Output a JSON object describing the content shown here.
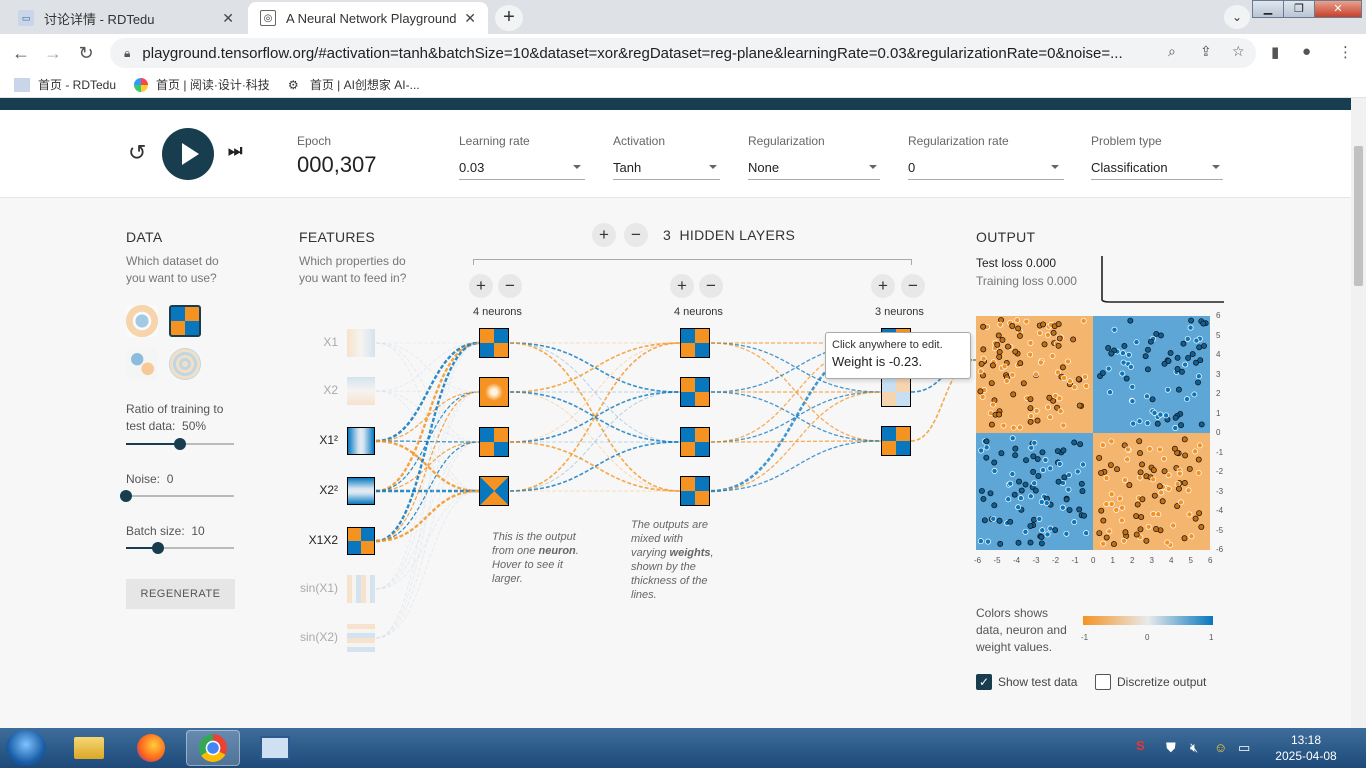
{
  "browser": {
    "tabs": [
      {
        "title": "讨论详情 - RDTedu",
        "active": false
      },
      {
        "title": "A Neural Network Playground",
        "active": true
      }
    ],
    "url": "playground.tensorflow.org/#activation=tanh&batchSize=10&dataset=xor&regDataset=reg-plane&learningRate=0.03&regularizationRate=0&noise=...",
    "bookmarks": [
      "首页 - RDTedu",
      "首页 | 阅读·设计·科技",
      "首页 | AI创想家 AI-..."
    ]
  },
  "controls": {
    "epoch_label": "Epoch",
    "epoch_value": "000,307",
    "learning_rate": {
      "label": "Learning rate",
      "value": "0.03"
    },
    "activation": {
      "label": "Activation",
      "value": "Tanh"
    },
    "regularization": {
      "label": "Regularization",
      "value": "None"
    },
    "regularization_rate": {
      "label": "Regularization rate",
      "value": "0"
    },
    "problem_type": {
      "label": "Problem type",
      "value": "Classification"
    }
  },
  "data_panel": {
    "title": "DATA",
    "question": "Which dataset do you want to use?",
    "ratio_label": "Ratio of training to test data:",
    "ratio_value": "50%",
    "ratio_fraction": 0.5,
    "noise_label": "Noise:",
    "noise_value": "0",
    "noise_fraction": 0,
    "batch_label": "Batch size:",
    "batch_value": "10",
    "batch_fraction": 0.3,
    "regenerate": "REGENERATE"
  },
  "features_panel": {
    "title": "FEATURES",
    "question": "Which properties do you want to feed in?",
    "features": [
      {
        "label": "X1",
        "active": false
      },
      {
        "label": "X2",
        "active": false
      },
      {
        "label": "X1²",
        "active": true
      },
      {
        "label": "X2²",
        "active": true
      },
      {
        "label": "X1X2",
        "active": true
      },
      {
        "label": "sin(X1)",
        "active": false
      },
      {
        "label": "sin(X2)",
        "active": false
      }
    ]
  },
  "network": {
    "hidden_layers_count": "3",
    "hidden_layers_label": "HIDDEN LAYERS",
    "layers": [
      {
        "neurons_label": "4 neurons"
      },
      {
        "neurons_label": "4 neurons"
      },
      {
        "neurons_label": "3 neurons"
      }
    ],
    "note1": {
      "pre": "This is the output from one",
      "bold": "neuron",
      "post": ". Hover to see it larger."
    },
    "note2": {
      "pre": "The outputs are mixed with varying",
      "bold": "weights",
      "post": ", shown by the thickness of the lines."
    },
    "tooltip": {
      "line1": "Click anywhere to edit.",
      "line2": "Weight is -0.23."
    }
  },
  "output_panel": {
    "title": "OUTPUT",
    "test_loss": "Test loss 0.000",
    "training_loss": "Training loss 0.000",
    "axis_ticks": [
      "-6",
      "-5",
      "-4",
      "-3",
      "-2",
      "-1",
      "0",
      "1",
      "2",
      "3",
      "4",
      "5",
      "6"
    ],
    "legend_text": "Colors shows data, neuron and weight values.",
    "legend_min": "-1",
    "legend_mid": "0",
    "legend_max": "1",
    "show_test_data": "Show test data",
    "show_test_checked": true,
    "discretize": "Discretize output",
    "discretize_checked": false
  },
  "colors": {
    "orange": "#f59322",
    "blue": "#0877bd",
    "dark": "#183d4e"
  },
  "taskbar": {
    "time": "13:18",
    "date": "2025-04-08"
  }
}
